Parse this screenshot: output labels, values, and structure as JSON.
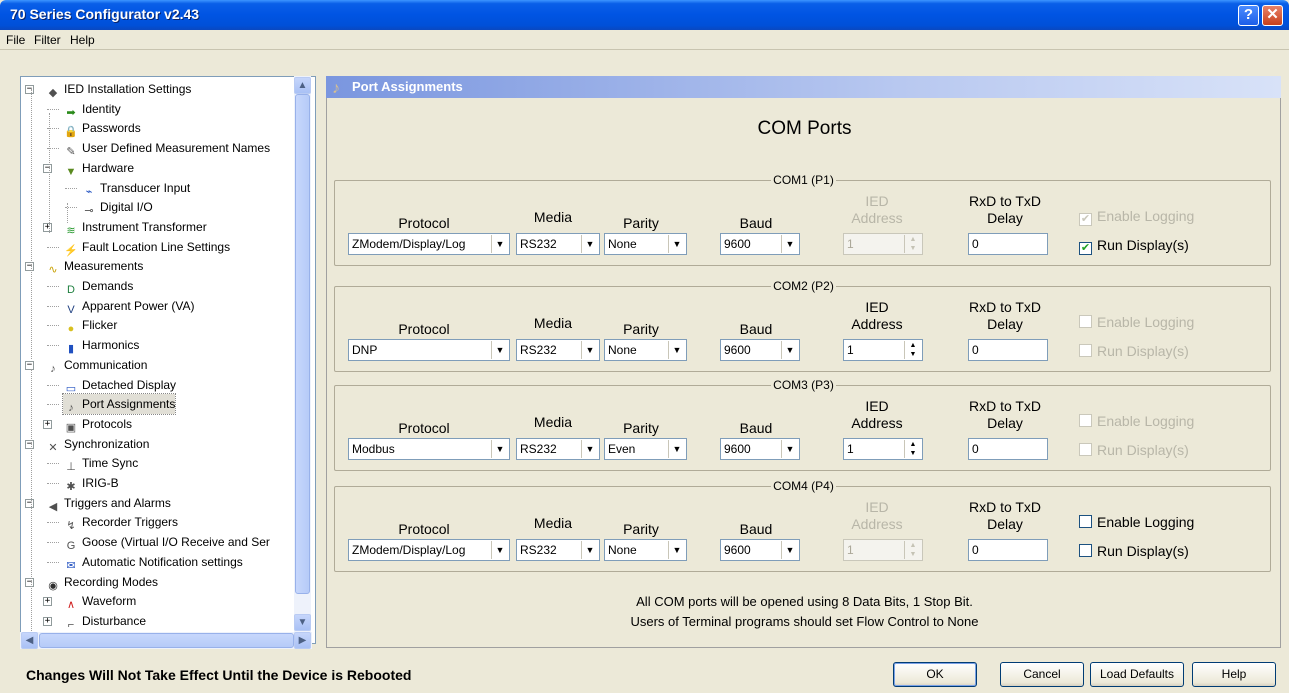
{
  "window": {
    "title": "70 Series Configurator v2.43",
    "help_glyph": "?",
    "close_glyph": "✕"
  },
  "menu": [
    "File",
    "Filter",
    "Help"
  ],
  "tree": [
    {
      "label": "IED Installation Settings",
      "icon": "ied-icon"
    },
    {
      "label": "Identity",
      "icon": "arrow-icon"
    },
    {
      "label": "Passwords",
      "icon": "lock-icon"
    },
    {
      "label": "User Defined Measurement Names",
      "icon": "names-icon"
    },
    {
      "label": "Hardware",
      "icon": "hardware-icon"
    },
    {
      "label": "Transducer Input",
      "icon": "transducer-icon"
    },
    {
      "label": "Digital I/O",
      "icon": "digital-io-icon"
    },
    {
      "label": "Instrument Transformer",
      "icon": "transformer-icon"
    },
    {
      "label": "Fault Location Line Settings",
      "icon": "fault-icon"
    },
    {
      "label": "Measurements",
      "icon": "measurements-icon"
    },
    {
      "label": "Demands",
      "icon": "demands-icon"
    },
    {
      "label": "Apparent Power (VA)",
      "icon": "va-icon"
    },
    {
      "label": "Flicker",
      "icon": "bulb-icon"
    },
    {
      "label": "Harmonics",
      "icon": "harmonics-icon"
    },
    {
      "label": "Communication",
      "icon": "communication-icon"
    },
    {
      "label": "Detached Display",
      "icon": "display-icon"
    },
    {
      "label": "Port Assignments",
      "icon": "port-icon"
    },
    {
      "label": "Protocols",
      "icon": "protocols-icon"
    },
    {
      "label": "Synchronization",
      "icon": "sync-icon"
    },
    {
      "label": "Time Sync",
      "icon": "time-sync-icon"
    },
    {
      "label": "IRIG-B",
      "icon": "irig-icon"
    },
    {
      "label": "Triggers and Alarms",
      "icon": "speaker-icon"
    },
    {
      "label": "Recorder Triggers",
      "icon": "trigger-icon"
    },
    {
      "label": "Goose (Virtual I/O Receive and Ser",
      "icon": "goose-icon"
    },
    {
      "label": "Automatic Notification settings",
      "icon": "notification-icon"
    },
    {
      "label": "Recording Modes",
      "icon": "recording-icon"
    },
    {
      "label": "Waveform",
      "icon": "waveform-icon"
    },
    {
      "label": "Disturbance",
      "icon": "disturbance-icon"
    }
  ],
  "panel": {
    "header": "Port Assignments",
    "title": "COM Ports",
    "labels": {
      "protocol": "Protocol",
      "media": "Media",
      "parity": "Parity",
      "baud": "Baud",
      "ied_address_1": "IED",
      "ied_address_2": "Address",
      "rxd_1": "RxD to TxD",
      "rxd_2": "Delay",
      "enable_logging": "Enable Logging",
      "run_display": "Run Display(s)"
    },
    "ports": [
      {
        "name": "COM1 (P1)",
        "protocol": "ZModem/Display/Log",
        "media": "RS232",
        "parity": "None",
        "baud": "9600",
        "ied_address": "1",
        "ied_enabled": false,
        "delay": "0",
        "enable_logging": {
          "checked": true,
          "enabled": false
        },
        "run_display": {
          "checked": true,
          "enabled": true
        }
      },
      {
        "name": "COM2 (P2)",
        "protocol": "DNP",
        "media": "RS232",
        "parity": "None",
        "baud": "9600",
        "ied_address": "1",
        "ied_enabled": true,
        "delay": "0",
        "enable_logging": {
          "checked": false,
          "enabled": false
        },
        "run_display": {
          "checked": false,
          "enabled": false
        }
      },
      {
        "name": "COM3 (P3)",
        "protocol": "Modbus",
        "media": "RS232",
        "parity": "Even",
        "baud": "9600",
        "ied_address": "1",
        "ied_enabled": true,
        "delay": "0",
        "enable_logging": {
          "checked": false,
          "enabled": false
        },
        "run_display": {
          "checked": false,
          "enabled": false
        }
      },
      {
        "name": "COM4 (P4)",
        "protocol": "ZModem/Display/Log",
        "media": "RS232",
        "parity": "None",
        "baud": "9600",
        "ied_address": "1",
        "ied_enabled": false,
        "delay": "0",
        "enable_logging": {
          "checked": false,
          "enabled": true
        },
        "run_display": {
          "checked": false,
          "enabled": true
        }
      }
    ],
    "footnote_1": "All COM ports will be opened using 8 Data Bits, 1 Stop Bit.",
    "footnote_2": "Users of Terminal programs should set Flow Control to None"
  },
  "status": "Changes Will Not Take Effect Until the Device is Rebooted",
  "buttons": {
    "ok": "OK",
    "cancel": "Cancel",
    "load_defaults": "Load Defaults",
    "help": "Help"
  }
}
